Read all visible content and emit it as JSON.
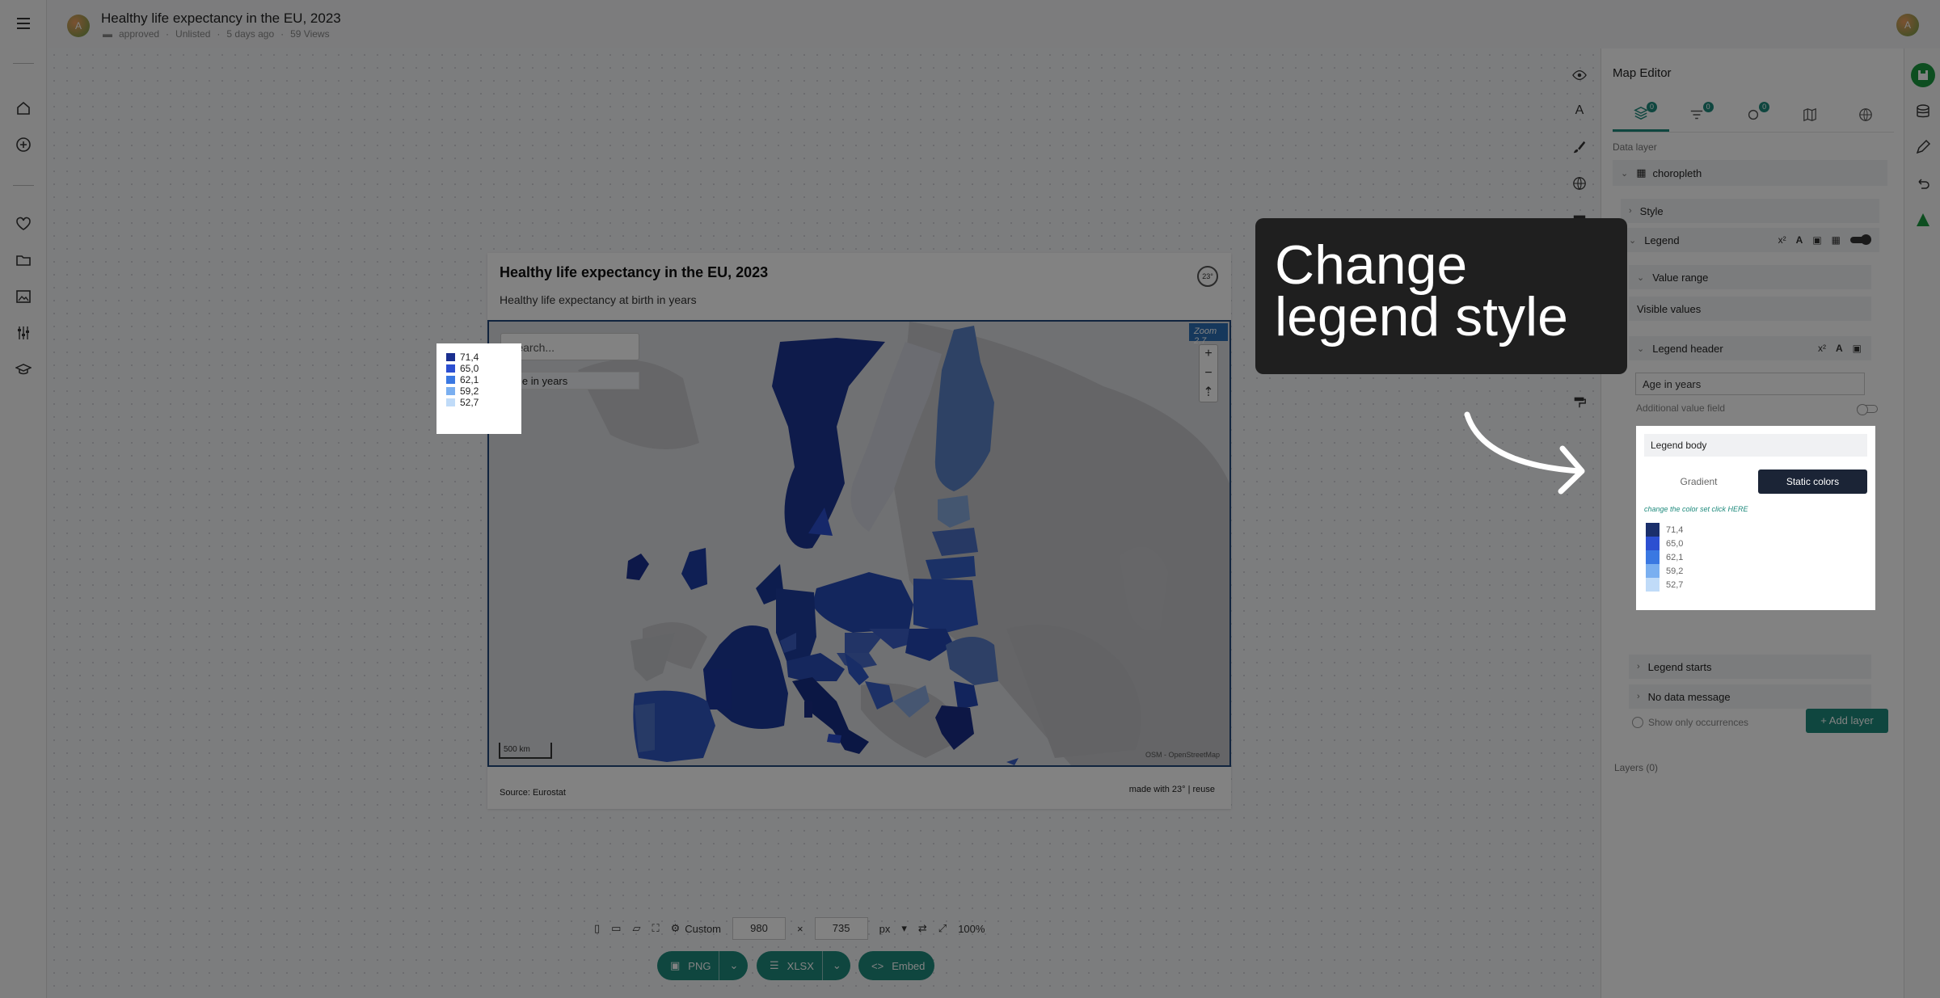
{
  "document": {
    "title": "Healthy life expectancy in the EU, 2023",
    "meta": {
      "status": "approved",
      "visibility": "Unlisted",
      "age": "5 days ago",
      "views": "59 Views"
    }
  },
  "user": {
    "initial": "A"
  },
  "chart": {
    "title": "Healthy life expectancy in the EU, 2023",
    "subtitle": "Healthy life expectancy at birth in years",
    "logo": "23°",
    "source": "Source: Eurostat",
    "made_with": "made with 23° | reuse"
  },
  "map": {
    "search_placeholder": "Search...",
    "legend_title": "Age in years",
    "zoom_label": "Zoom 2.7",
    "zoom_in": "+",
    "zoom_out": "−",
    "reset": "⇡",
    "scale": "500 km",
    "attribution": "OSM - OpenStreetMap",
    "legend": [
      {
        "label": "71,4",
        "color": "#1a2f8f"
      },
      {
        "label": "65,0",
        "color": "#2c4fd1"
      },
      {
        "label": "62,1",
        "color": "#3a78e2"
      },
      {
        "label": "59,2",
        "color": "#7aaff0"
      },
      {
        "label": "52,7",
        "color": "#c0dbf8"
      }
    ]
  },
  "panel": {
    "title": "Map Editor",
    "tabs": [
      {
        "icon": "layers-icon",
        "badge": "0"
      },
      {
        "icon": "filter-icon",
        "badge": "0"
      },
      {
        "icon": "marker-icon",
        "badge": "0"
      },
      {
        "icon": "map-icon",
        "badge": ""
      },
      {
        "icon": "globe-icon",
        "badge": ""
      }
    ],
    "data_layer_label": "Data layer",
    "layer_name": "choropleth",
    "style_label": "Style",
    "legend_label": "Legend",
    "superscript": "x²",
    "font_a": "A",
    "value_range_label": "Value range",
    "visible_values_label": "Visible values",
    "legend_header_label": "Legend header",
    "legend_header_value": "Age in years",
    "additional_value_label": "Additional value field",
    "legend_body_label": "Legend body",
    "gradient_label": "Gradient",
    "static_colors_label": "Static colors",
    "color_set_link": "change the color set click HERE",
    "legend_starts_label": "Legend starts",
    "no_data_label": "No data message",
    "show_only_label": "Show only occurrences",
    "layers_count_label": "Layers (0)",
    "add_layer_label": "+ Add layer"
  },
  "bottom": {
    "preset": "Custom",
    "width": "980",
    "times": "×",
    "height": "735",
    "unit": "px",
    "zoom": "100%",
    "png_label": "PNG",
    "xlsx_label": "XLSX",
    "embed_label": "Embed"
  },
  "callout": {
    "text": "Change legend style"
  },
  "colors": {
    "accent": "#1e8a7c",
    "dark": "#1b2436"
  }
}
